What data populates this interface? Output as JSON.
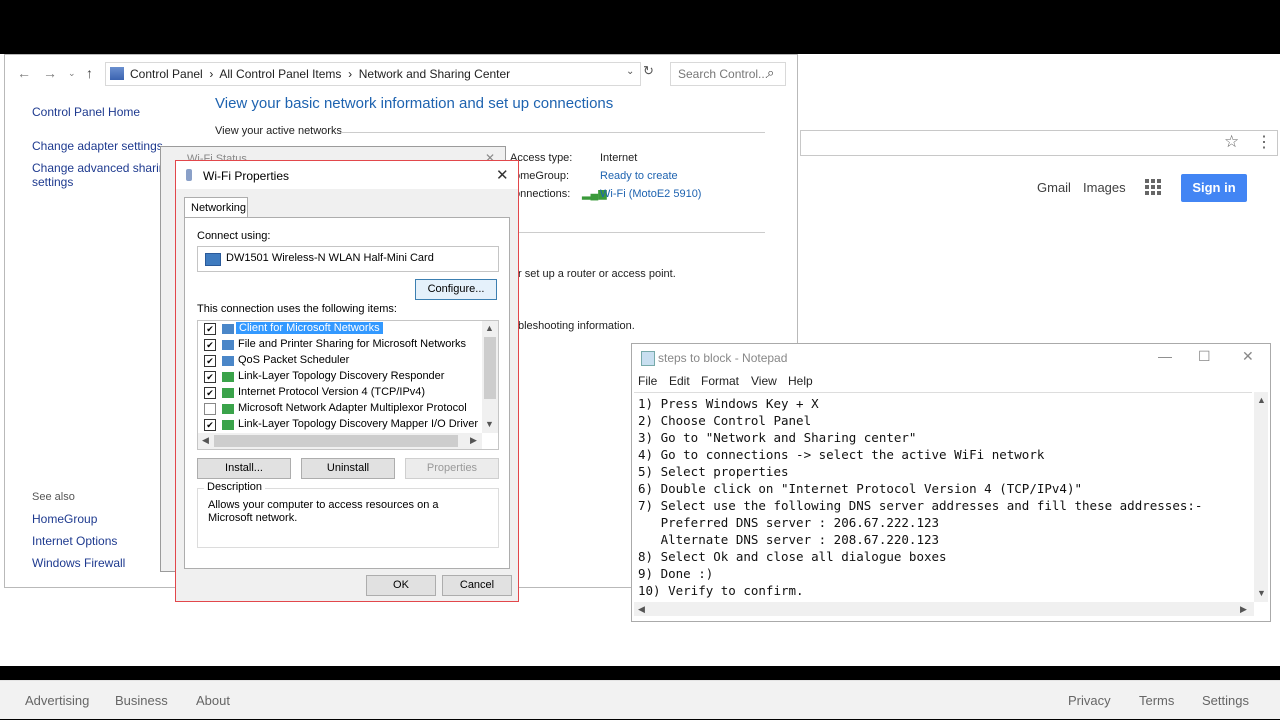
{
  "google": {
    "gmail": "Gmail",
    "images": "Images",
    "sign_in": "Sign in",
    "footer_left": [
      "Advertising",
      "Business",
      "About"
    ],
    "footer_right": [
      "Privacy",
      "Terms",
      "Settings"
    ]
  },
  "control_panel": {
    "breadcrumb": "Control Panel  ›  All Control Panel Items  ›  Network and Sharing Center",
    "search_placeholder": "Search Control...",
    "sidebar": {
      "home": "Control Panel Home",
      "change_adapter": "Change adapter settings",
      "change_advanced_1": "Change advanced sharing",
      "change_advanced_2": "settings",
      "see_also": "See also",
      "links": [
        "HomeGroup",
        "Internet Options",
        "Windows Firewall"
      ]
    },
    "title": "View your basic network information and set up connections",
    "active_networks": "View your active networks",
    "access_type_label": "Access type:",
    "access_type_value": "Internet",
    "homegroup_label": "omeGroup:",
    "homegroup_value": "Ready to create",
    "connections_label": "onnections:",
    "connections_value": "Wi-Fi (MotoE2 5910)",
    "setup_text": "r set up a router or access point.",
    "troubleshoot_text": "bleshooting information."
  },
  "wifi_status": {
    "title": "Wi-Fi Status"
  },
  "wifi_properties": {
    "title": "Wi-Fi Properties",
    "tab": "Networking",
    "connect_using": "Connect using:",
    "adapter": "DW1501 Wireless-N WLAN Half-Mini Card",
    "configure": "Configure...",
    "uses_label": "This connection uses the following items:",
    "items": [
      {
        "label": "Client for Microsoft Networks",
        "checked": "✔"
      },
      {
        "label": "File and Printer Sharing for Microsoft Networks",
        "checked": "✔"
      },
      {
        "label": "QoS Packet Scheduler",
        "checked": "✔"
      },
      {
        "label": "Link-Layer Topology Discovery Responder",
        "checked": "✔"
      },
      {
        "label": "Internet Protocol Version 4 (TCP/IPv4)",
        "checked": "✔"
      },
      {
        "label": "Microsoft Network Adapter Multiplexor Protocol",
        "checked": ""
      },
      {
        "label": "Link-Layer Topology Discovery Mapper I/O Driver",
        "checked": "✔"
      }
    ],
    "install": "Install...",
    "uninstall": "Uninstall",
    "properties": "Properties",
    "description_legend": "Description",
    "description": "Allows your computer to access resources on a Microsoft network.",
    "ok": "OK",
    "cancel": "Cancel"
  },
  "notepad": {
    "title": "steps to block - Notepad",
    "menu": [
      "File",
      "Edit",
      "Format",
      "View",
      "Help"
    ],
    "text": "1) Press Windows Key + X\n2) Choose Control Panel\n3) Go to \"Network and Sharing center\"\n4) Go to connections -> select the active WiFi network\n5) Select properties\n6) Double click on \"Internet Protocol Version 4 (TCP/IPv4)\"\n7) Select use the following DNS server addresses and fill these addresses:-\n   Preferred DNS server : 206.67.222.123\n   Alternate DNS server : 208.67.220.123\n8) Select Ok and close all dialogue boxes\n9) Done :)\n10) Verify to confirm."
  }
}
